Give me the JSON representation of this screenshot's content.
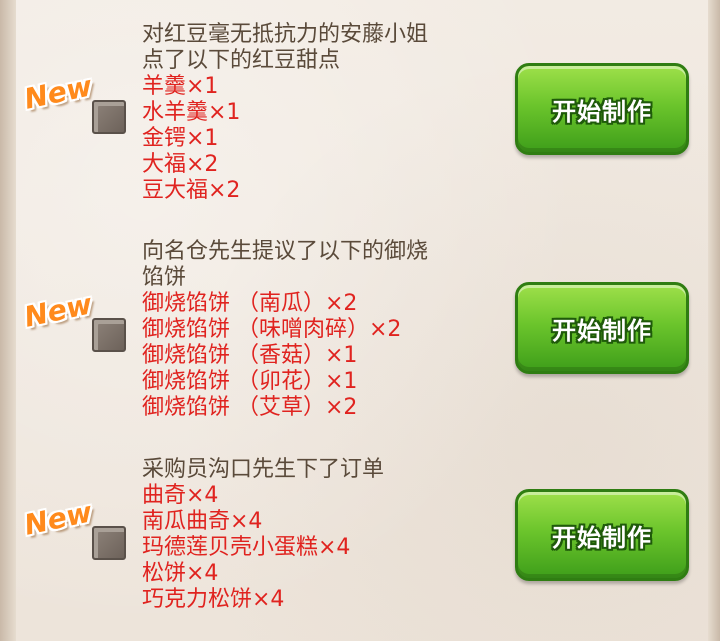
{
  "orders": [
    {
      "title_lines": [
        "对红豆毫无抵抗力的安藤小姐",
        "点了以下的红豆甜点"
      ],
      "items": [
        "羊羹×1",
        "水羊羹×1",
        "金锷×1",
        "大福×2",
        "豆大福×2"
      ],
      "badge": "New",
      "button_label": "开始制作"
    },
    {
      "title_lines": [
        "向名仓先生提议了以下的御烧",
        "馅饼"
      ],
      "items": [
        "御烧馅饼 （南瓜）×2",
        "御烧馅饼 （味噌肉碎）×2",
        "御烧馅饼 （香菇）×1",
        "御烧馅饼 （卯花）×1",
        "御烧馅饼 （艾草）×2"
      ],
      "badge": "New",
      "button_label": "开始制作"
    },
    {
      "title_lines": [
        "采购员沟口先生下了订单"
      ],
      "items": [
        "曲奇×4",
        "南瓜曲奇×4",
        "玛德莲贝壳小蛋糕×4",
        "松饼×4",
        "巧克力松饼×4"
      ],
      "badge": "New",
      "button_label": "开始制作"
    }
  ],
  "colors": {
    "title": "#5a4a3a",
    "item": "#e0231f",
    "button": "#6cc52c",
    "badge": "#ff8a1c"
  },
  "icons": {
    "badge_icon": "new-badge-icon",
    "order_icon": "order-document-icon"
  }
}
